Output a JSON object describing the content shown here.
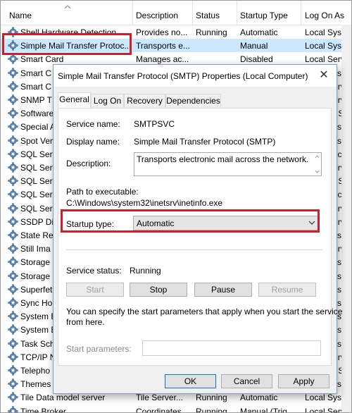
{
  "columns": {
    "name": "Name",
    "description": "Description",
    "status": "Status",
    "startup_type": "Startup Type",
    "log_on_as": "Log On As"
  },
  "services": [
    {
      "name": "Shell Hardware Detection",
      "description": "Provides no...",
      "status": "Running",
      "startup_type": "Automatic",
      "log_on_as": "Local Syste..."
    },
    {
      "name": "Simple Mail Transfer Protoc...",
      "description": "Transports e...",
      "status": "",
      "startup_type": "Manual",
      "log_on_as": "Local Syste..."
    },
    {
      "name": "Smart Card",
      "description": "Manages ac...",
      "status": "",
      "startup_type": "Disabled",
      "log_on_as": "Local Service"
    },
    {
      "name": "Smart C",
      "log_on_as": "Local Syste..."
    },
    {
      "name": "Smart C",
      "log_on_as": "Local Service"
    },
    {
      "name": "SNMP T",
      "log_on_as": "Local Service"
    },
    {
      "name": "Software",
      "log_on_as": "Network S..."
    },
    {
      "name": "Special A",
      "log_on_as": "Local Syste..."
    },
    {
      "name": "Spot Ver",
      "log_on_as": "Local Syste..."
    },
    {
      "name": "SQL Serv",
      "log_on_as": "NT Service..."
    },
    {
      "name": "SQL Serv",
      "log_on_as": "Local Service"
    },
    {
      "name": "SQL Serv",
      "log_on_as": "Network S..."
    },
    {
      "name": "SQL Serv",
      "log_on_as": "NT Service..."
    },
    {
      "name": "SQL Serv",
      "log_on_as": "Local Service"
    },
    {
      "name": "SSDP Dis",
      "log_on_as": "Local Service"
    },
    {
      "name": "State Re",
      "log_on_as": "Local Syste..."
    },
    {
      "name": "Still Ima",
      "log_on_as": "Local Service"
    },
    {
      "name": "Storage",
      "log_on_as": "Local Syste..."
    },
    {
      "name": "Storage",
      "log_on_as": "Local Syste..."
    },
    {
      "name": "Superfet",
      "log_on_as": "Local Syste..."
    },
    {
      "name": "Sync Ho",
      "log_on_as": "Local Syste..."
    },
    {
      "name": "System E",
      "log_on_as": "Local Syste..."
    },
    {
      "name": "System E",
      "log_on_as": "Local Syste..."
    },
    {
      "name": "Task Sch",
      "log_on_as": "Local Syste..."
    },
    {
      "name": "TCP/IP N",
      "log_on_as": "Local Service"
    },
    {
      "name": "Telepho",
      "log_on_as": "Network S..."
    },
    {
      "name": "Themes",
      "log_on_as": "Local Syste..."
    },
    {
      "name": "Tile Data model server",
      "description": "Tile Server...",
      "status": "Running",
      "startup_type": "Automatic",
      "log_on_as": "Local Syste..."
    },
    {
      "name": "Time Broker",
      "description": "Coordinates...",
      "status": "Running",
      "startup_type": "Manual (Trig...",
      "log_on_as": "Local Service"
    }
  ],
  "dialog": {
    "title": "Simple Mail Transfer Protocol (SMTP) Properties (Local Computer)",
    "tabs": [
      "General",
      "Log On",
      "Recovery",
      "Dependencies"
    ],
    "service_name_label": "Service name:",
    "service_name": "SMTPSVC",
    "display_name_label": "Display name:",
    "display_name": "Simple Mail Transfer Protocol (SMTP)",
    "description_label": "Description:",
    "description": "Transports electronic mail across the network.",
    "path_label": "Path to executable:",
    "path": "C:\\Windows\\system32\\inetsrv\\inetinfo.exe",
    "startup_type_label": "Startup type:",
    "startup_type": "Automatic",
    "service_status_label": "Service status:",
    "service_status": "Running",
    "buttons": {
      "start": "Start",
      "stop": "Stop",
      "pause": "Pause",
      "resume": "Resume"
    },
    "help_text_1": "You can specify the start parameters that apply when you start the service",
    "help_text_2": "from here.",
    "start_params_label": "Start parameters:",
    "start_params_value": "",
    "ok": "OK",
    "cancel": "Cancel",
    "apply": "Apply"
  },
  "colors": {
    "highlight": "#c8202c",
    "accent": "#0078d7"
  }
}
